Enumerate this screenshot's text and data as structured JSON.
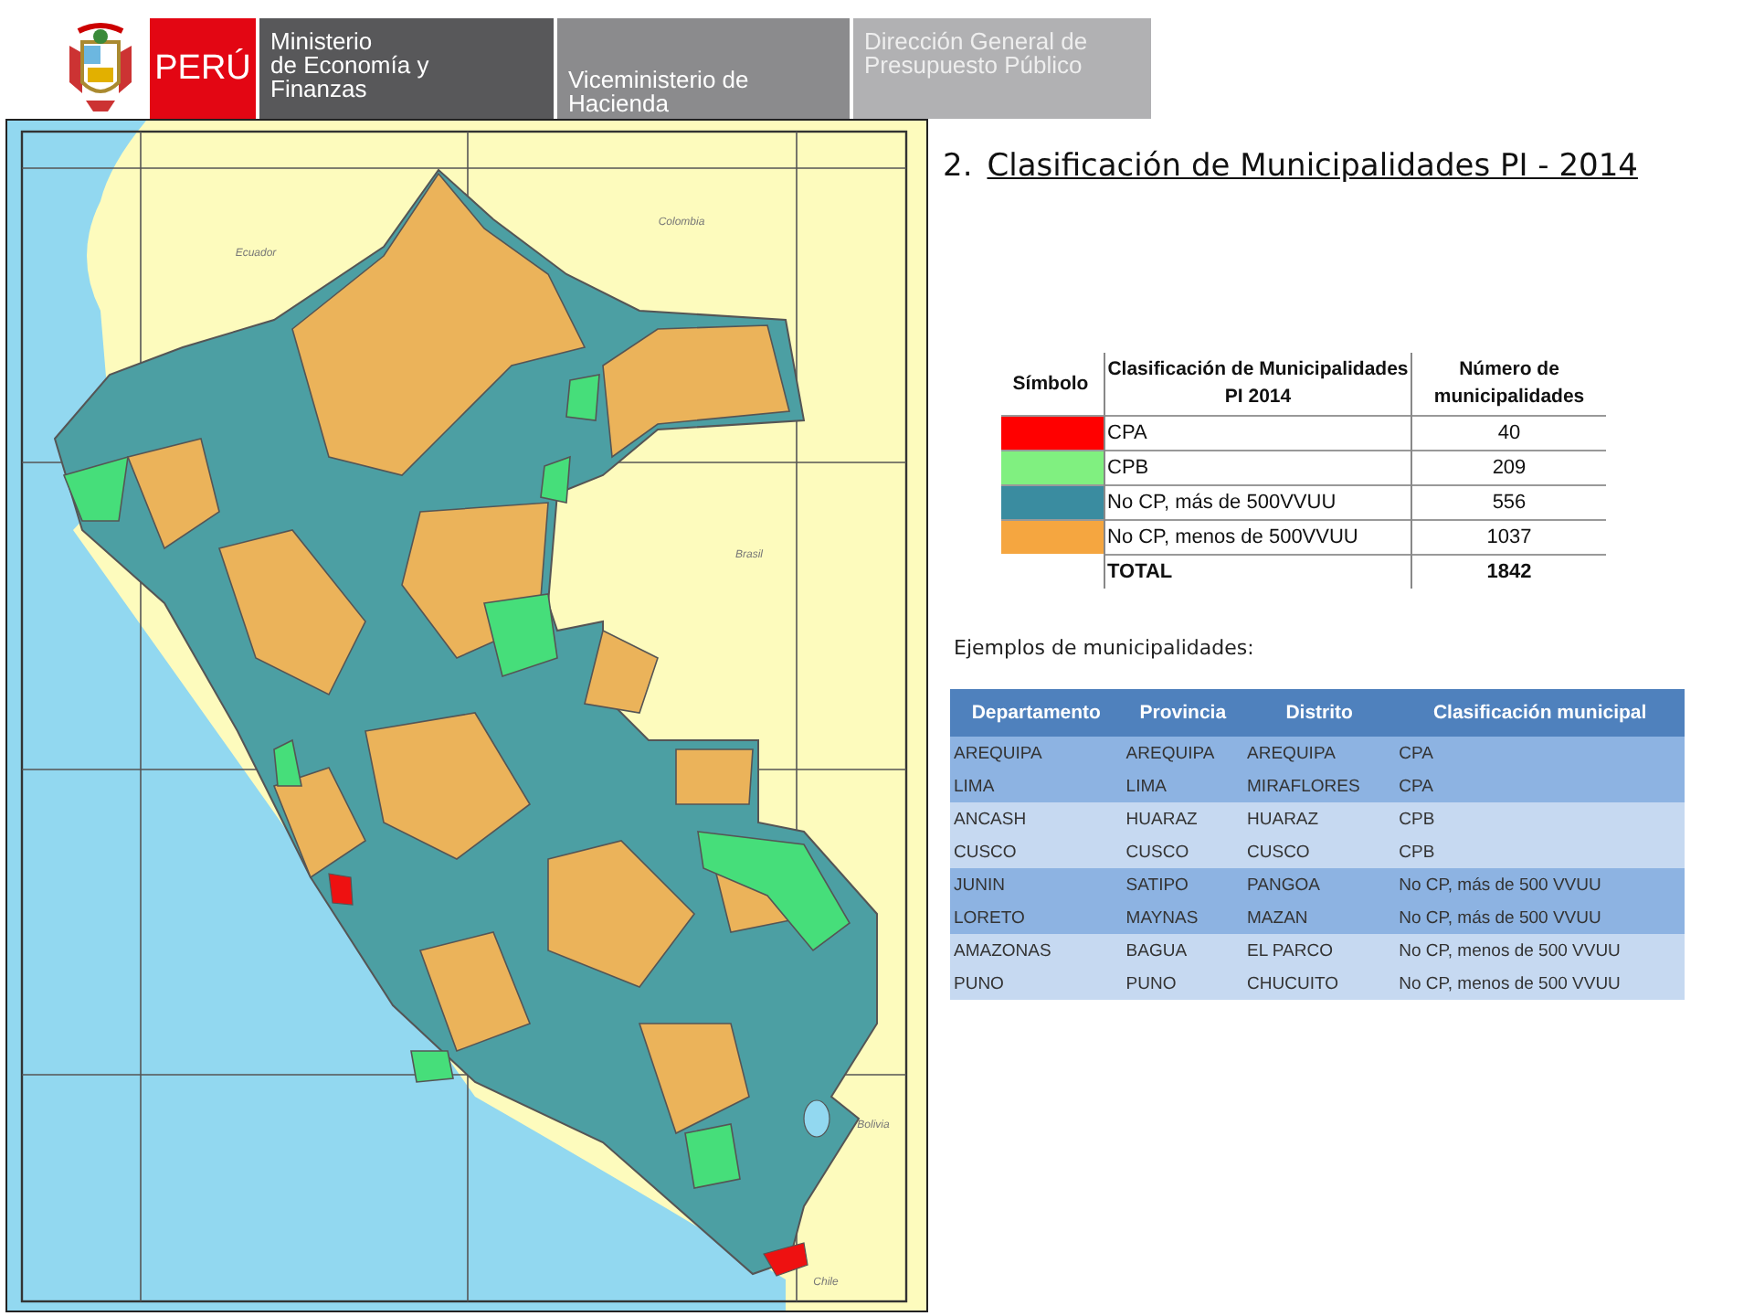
{
  "header": {
    "country": "PERÚ",
    "blocks": [
      {
        "lines": [
          "Ministerio",
          "de Economía y",
          "Finanzas"
        ]
      },
      {
        "lines": [
          "Viceministerio  de",
          "Hacienda"
        ]
      },
      {
        "lines": [
          "Dirección  General de",
          "Presupuesto  Público"
        ]
      }
    ]
  },
  "map": {
    "labels": [
      "Ecuador",
      "Colombia",
      "Brasil",
      "Bolivia",
      "Chile"
    ]
  },
  "title": {
    "number": "2.",
    "text": "Clasificación de Municipalidades PI - 2014"
  },
  "legend": {
    "columns": [
      "Símbolo",
      "Clasificación de Municipalidades PI 2014",
      "Número de municipalidades"
    ],
    "rows": [
      {
        "color": "#ff0000",
        "label": "CPA",
        "count": "40"
      },
      {
        "color": "#80f080",
        "label": "CPB",
        "count": "209"
      },
      {
        "color": "#3a8ca0",
        "label": "No CP, más de 500VVUU",
        "count": "556"
      },
      {
        "color": "#f5a640",
        "label": "No CP, menos de 500VVUU",
        "count": "1037"
      }
    ],
    "total": {
      "label": "TOTAL",
      "count": "1842"
    }
  },
  "examples": {
    "caption": "Ejemplos de municipalidades:",
    "columns": [
      "Departamento",
      "Provincia",
      "Distrito",
      "Clasificación  municipal"
    ],
    "rows": [
      [
        "AREQUIPA",
        "AREQUIPA",
        "AREQUIPA",
        "CPA"
      ],
      [
        "LIMA",
        "LIMA",
        "MIRAFLORES",
        "CPA"
      ],
      [
        "ANCASH",
        "HUARAZ",
        "HUARAZ",
        "CPB"
      ],
      [
        "CUSCO",
        "CUSCO",
        "CUSCO",
        "CPB"
      ],
      [
        "JUNIN",
        "SATIPO",
        "PANGOA",
        "No CP, más de 500 VVUU"
      ],
      [
        "LORETO",
        "MAYNAS",
        "MAZAN",
        "No CP, más de 500 VVUU"
      ],
      [
        "AMAZONAS",
        "BAGUA",
        "EL PARCO",
        "No CP, menos de 500 VVUU"
      ],
      [
        "PUNO",
        "PUNO",
        "CHUCUITO",
        "No CP, menos de 500 VVUU"
      ]
    ]
  }
}
